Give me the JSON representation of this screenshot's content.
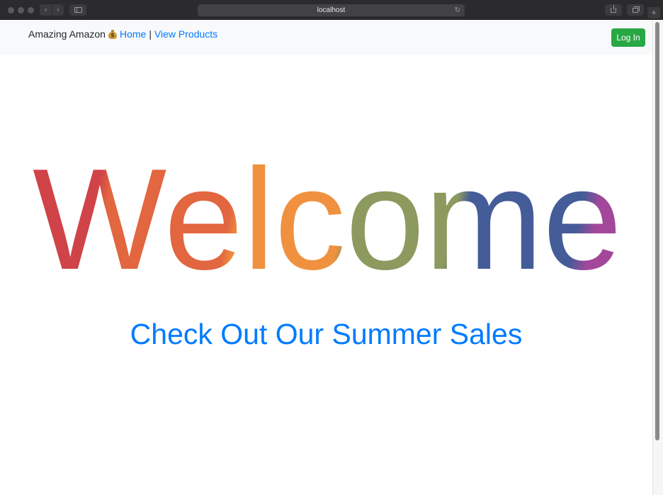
{
  "browser": {
    "url": "localhost",
    "reload_icon": "↻",
    "back_icon": "‹",
    "forward_icon": "›",
    "new_tab_icon": "+"
  },
  "navbar": {
    "brand": "Amazing Amazon",
    "brand_icon": "money-bag",
    "links": [
      "Home",
      "View Products"
    ],
    "separator": "|",
    "login_label": "Log In",
    "login_color": "#28a745",
    "link_color": "#007bff"
  },
  "hero": {
    "welcome": "Welcome",
    "welcome_colors": [
      "#cf4349",
      "#e2663f",
      "#f0913f",
      "#8c9a5f",
      "#445c98",
      "#a3479a"
    ],
    "headline": "Check Out Our Summer Sales"
  }
}
